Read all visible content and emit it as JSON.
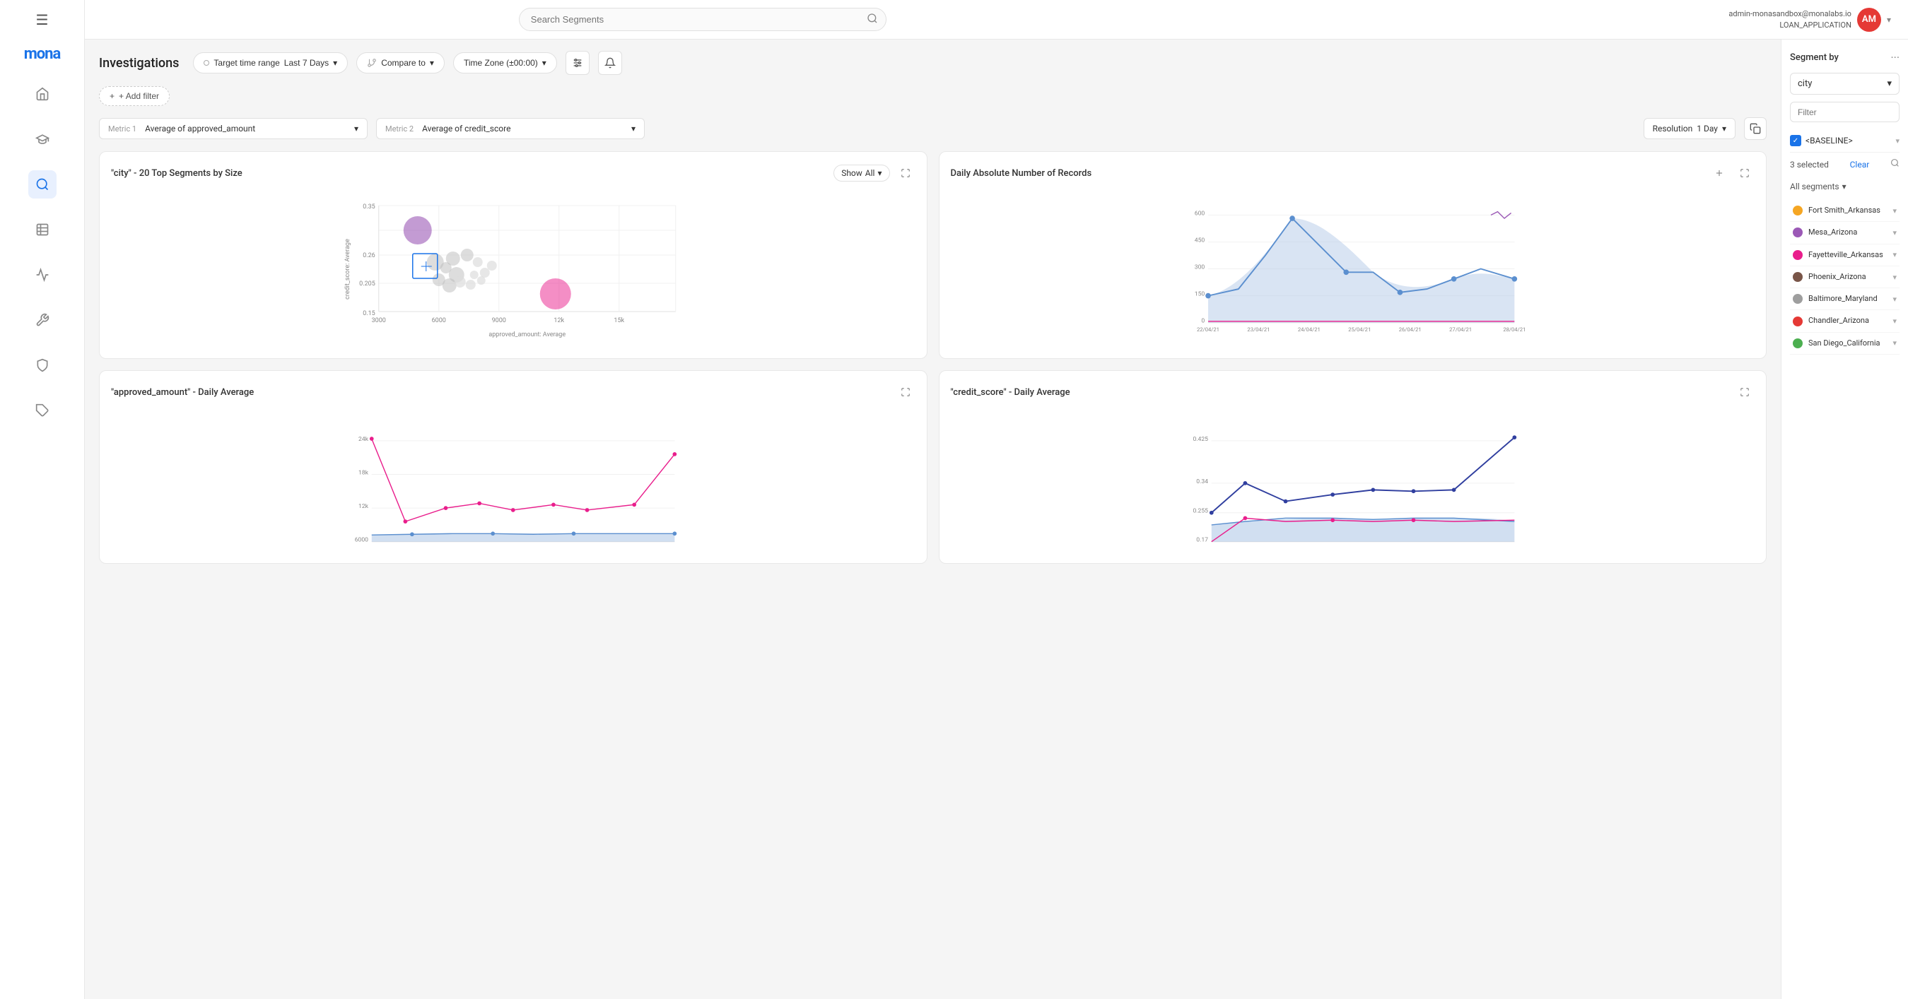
{
  "app": {
    "name": "mona",
    "logo": "mona"
  },
  "topbar": {
    "search_placeholder": "Search Segments",
    "user_email": "admin-monasandbox@monalabs.io",
    "user_app": "LOAN_APPLICATION",
    "user_initials": "AM"
  },
  "header": {
    "title": "Investigations",
    "target_label": "Target time range",
    "target_value": "Last 7 Days",
    "compare_label": "Compare to",
    "timezone_label": "Time Zone (±00:00)"
  },
  "filters": {
    "add_filter_label": "+ Add filter"
  },
  "metrics": {
    "metric1_label": "Metric 1",
    "metric1_value": "Average of approved_amount",
    "metric2_label": "Metric 2",
    "metric2_value": "Average of credit_score",
    "resolution_label": "Resolution",
    "resolution_value": "1 Day"
  },
  "charts": {
    "scatter": {
      "title": "\"city\" - 20 Top Segments by Size",
      "show_label": "Show",
      "show_value": "All",
      "x_label": "approved_amount: Average",
      "y_label": "credit_score: Average",
      "x_ticks": [
        "3000",
        "6000",
        "9000",
        "12k",
        "15k"
      ],
      "y_ticks": [
        "0.15",
        "0.205",
        "0.26",
        "0.35"
      ]
    },
    "daily_records": {
      "title": "Daily Absolute Number of Records",
      "y_ticks": [
        "0",
        "150",
        "300",
        "450",
        "600"
      ],
      "x_ticks": [
        "22/04/21",
        "23/04/21",
        "24/04/21",
        "25/04/21",
        "26/04/21",
        "27/04/21",
        "28/04/21"
      ]
    },
    "approved_amount": {
      "title": "\"approved_amount\" - Daily Average",
      "y_ticks": [
        "6000",
        "12k",
        "18k",
        "24k"
      ]
    },
    "credit_score": {
      "title": "\"credit_score\" - Daily Average",
      "y_ticks": [
        "0.17",
        "0.255",
        "0.34",
        "0.425"
      ]
    }
  },
  "segment_by": {
    "title": "Segment by",
    "value": "city",
    "filter_placeholder": "Filter",
    "baseline_label": "<BASELINE>",
    "selected_count": "3 selected",
    "clear_label": "Clear",
    "all_segments_label": "All segments",
    "segments": [
      {
        "name": "Fort Smith_Arkansas",
        "color": "#f5a623"
      },
      {
        "name": "Mesa_Arizona",
        "color": "#9b59b6"
      },
      {
        "name": "Fayetteville_Arkansas",
        "color": "#e91e8c"
      },
      {
        "name": "Phoenix_Arizona",
        "color": "#795548"
      },
      {
        "name": "Baltimore_Maryland",
        "color": "#9e9e9e"
      },
      {
        "name": "Chandler_Arizona",
        "color": "#e53935"
      },
      {
        "name": "San Diego_California",
        "color": "#4caf50"
      }
    ]
  },
  "icons": {
    "menu": "☰",
    "home": "⌂",
    "graduation": "🎓",
    "search": "⚲",
    "file": "📄",
    "book": "📚",
    "wrench": "🔧",
    "shield": "🛡",
    "tag": "🏷",
    "bell": "🔔",
    "settings": "⚙",
    "chevron_down": "▾",
    "chevron_right": "›",
    "expand": "⤢",
    "copy": "⧉",
    "more": "···",
    "plus": "+"
  }
}
